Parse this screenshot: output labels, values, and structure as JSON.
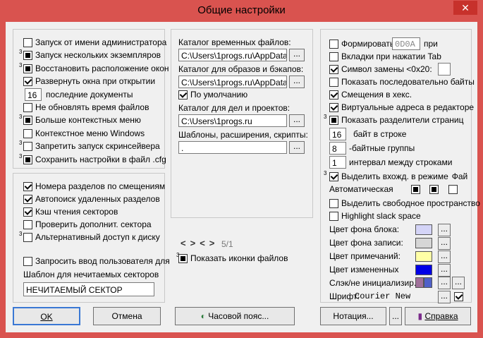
{
  "window": {
    "title": "Общие настройки",
    "close_glyph": "✕"
  },
  "left_top": {
    "items": [
      {
        "label": "Запуск от имени администратора",
        "state": "unchecked"
      },
      {
        "label": "Запуск нескольких экземпляров",
        "state": "square",
        "marker": "3"
      },
      {
        "label": "Восстановить расположение окон",
        "state": "square",
        "marker": "3"
      },
      {
        "label": "Развернуть окна при открытии",
        "state": "checked"
      },
      {
        "label": "последние документы",
        "value": "16"
      },
      {
        "label": "Не обновлять время файлов",
        "state": "unchecked"
      },
      {
        "label": "Больше контекстных меню",
        "state": "square",
        "marker": "3"
      },
      {
        "label": "Контекстное меню Windows",
        "state": "unchecked"
      },
      {
        "label": "Запретить запуск скринсейвера",
        "state": "unchecked",
        "marker": "3"
      },
      {
        "label": "Сохранить настройки в файл .cfg",
        "state": "square",
        "marker": "3"
      }
    ]
  },
  "left_bottom": {
    "items": [
      {
        "label": "Номера разделов по смещениям",
        "state": "checked"
      },
      {
        "label": "Автопоиск удаленных разделов",
        "state": "checked"
      },
      {
        "label": "Кэш чтения секторов",
        "state": "checked"
      },
      {
        "label": "Проверить дополнит. сектора",
        "state": "unchecked"
      },
      {
        "label": "Альтернативный доступ к диску",
        "state": "unchecked",
        "marker": "3"
      },
      {
        "label": "Запросить ввод пользователя для",
        "state": "unchecked"
      }
    ],
    "template_label": "Шаблон для нечитаемых секторов",
    "template_value": "НЕЧИТАЕМЫЙ СЕКТОР"
  },
  "middle": {
    "temp_label": "Каталог временных файлов:",
    "temp_value": "C:\\Users\\1progs.ru\\AppData\\L",
    "images_label": "Каталог для образов и бэкапов:",
    "images_value": "C:\\Users\\1progs.ru\\AppData\\L",
    "default_label": "По умолчанию",
    "projects_label": "Каталог для дел и проектов:",
    "projects_value": "C:\\Users\\1progs.ru",
    "templates_label": "Шаблоны, расширения, скрипты:",
    "templates_value": ".",
    "browse": "...",
    "nav_arrows": [
      "<",
      ">",
      "<",
      ">"
    ],
    "nav_page": "5/1",
    "show_icons_label": "Показать иконки файлов"
  },
  "right": {
    "form_label": "Формировать",
    "form_value": "0D0A",
    "form_suffix": "при",
    "tabs_label": "Вкладки при нажатии Tab",
    "replace_label": "Символ замены <0x20:",
    "show_bytes_label": "Показать последовательно байты",
    "hex_offsets_label": "Смещения в хекс.",
    "virtual_label": "Виртуальные адреса в редакторе",
    "separators_label": "Показать разделители страниц",
    "bytes_per_line_value": "16",
    "bytes_per_line_label": "байт в строке",
    "groups_value": "8",
    "groups_label": "-байтные группы",
    "interval_value": "1",
    "interval_label": "интервал между строками",
    "select_label": "Выделить вхожд. в режиме",
    "select_suffix": "Фай",
    "auto_label": "Автоматическая",
    "free_space_label": "Выделить свободное пространство",
    "slack_label": "Highlight slack space",
    "colors": [
      {
        "label": "Цвет фона блока:",
        "color": "#d4d4f7"
      },
      {
        "label": "Цвет фона записи:",
        "color": "#d6d6d6"
      },
      {
        "label": "Цвет примечаний:",
        "color": "#ffffa6"
      },
      {
        "label": "Цвет измененных",
        "color": "#0000e6"
      }
    ],
    "slack_color_label": "Слэк/не инициализир.:",
    "slack_colors": [
      "#a0709a",
      "#5060c8"
    ],
    "font_label": "Шрифт:",
    "font_value": "Courier New"
  },
  "buttons": {
    "ok": "OK",
    "cancel": "Отмена",
    "timezone": "Часовой пояс...",
    "notation": "Нотация...",
    "dots": "...",
    "help": "Справка"
  }
}
